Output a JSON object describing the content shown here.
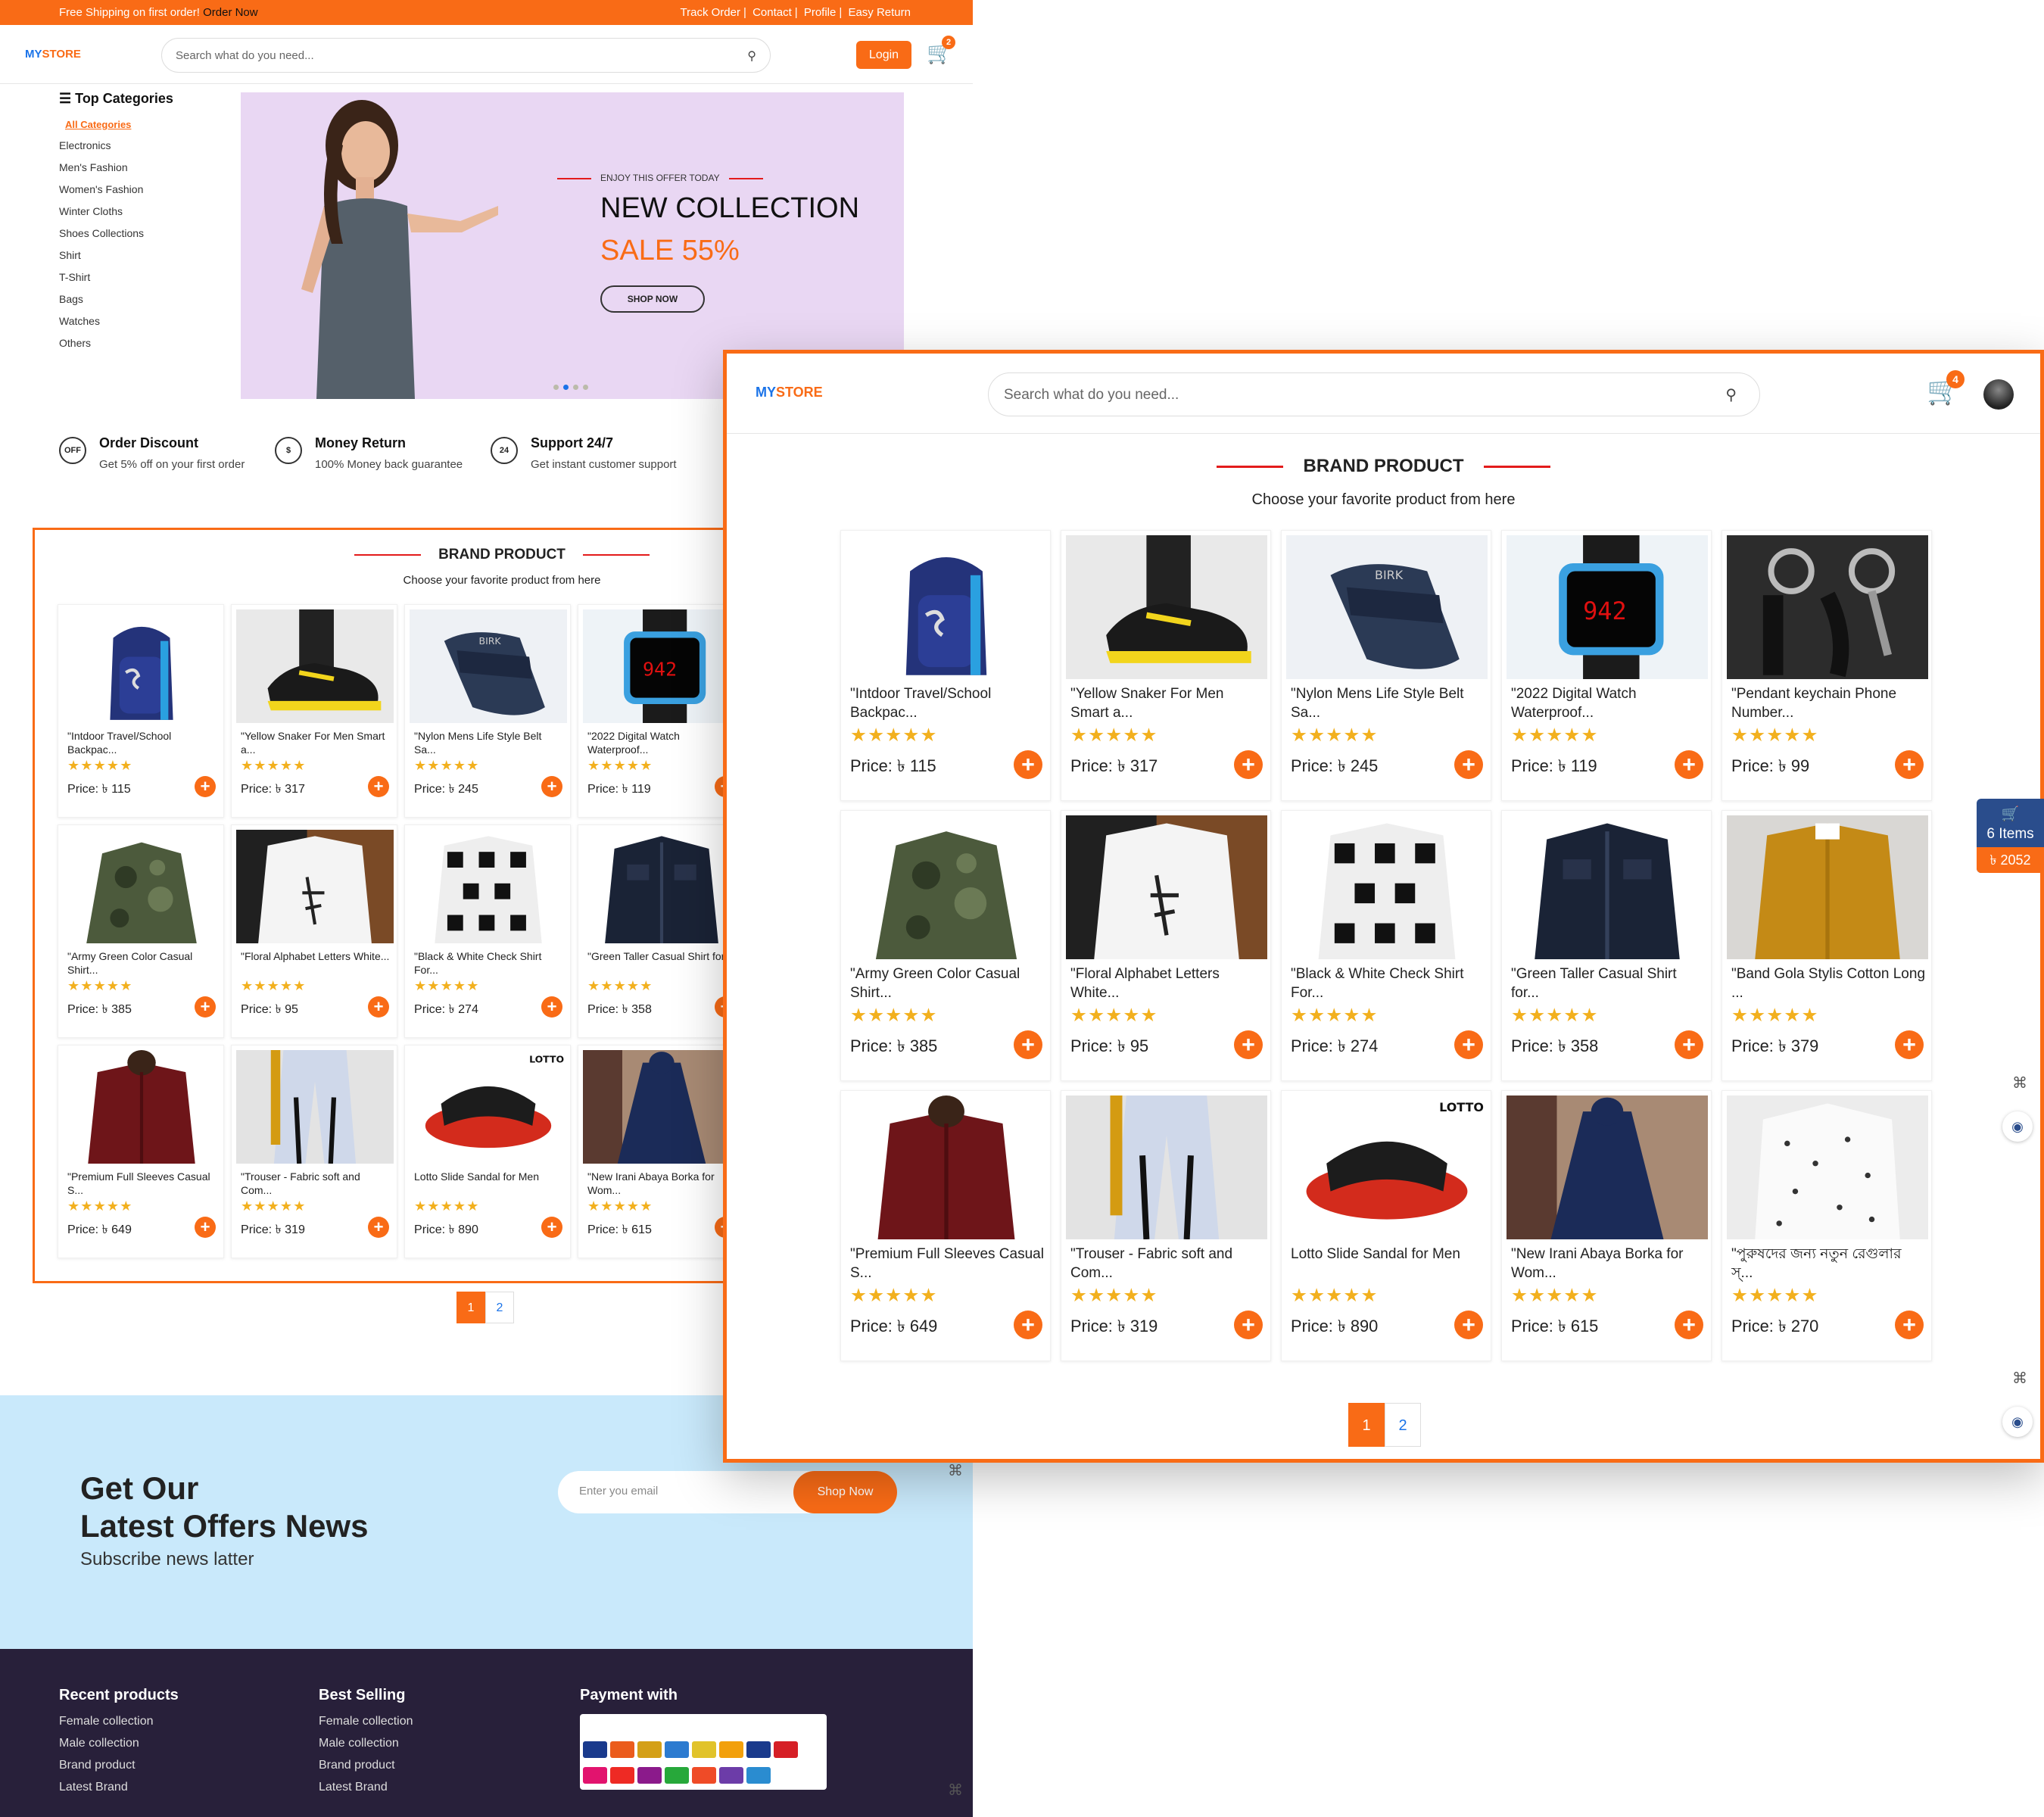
{
  "topbar": {
    "promo": "Free Shipping on first order! ",
    "promo_link": "Order Now",
    "links": [
      "Track Order",
      "Contact",
      "Profile",
      "Easy Return"
    ]
  },
  "brand": {
    "my": "MY",
    "store": "STORE"
  },
  "search": {
    "placeholder": "Search what do you need..."
  },
  "header": {
    "login": "Login",
    "cart_count_small": "2",
    "cart_count_large": "4"
  },
  "categories": {
    "title": "Top Categories",
    "all": "All Categories",
    "items": [
      "Electronics",
      "Men's Fashion",
      "Women's Fashion",
      "Winter Cloths",
      "Shoes Collections",
      "Shirt",
      "T-Shirt",
      "Bags",
      "Watches",
      "Others"
    ]
  },
  "banner": {
    "kicker": "ENJOY THIS OFFER TODAY",
    "title": "NEW COLLECTION",
    "sale": "SALE 55%",
    "button": "SHOP NOW",
    "slide_count": 4,
    "active_slide": 2
  },
  "features": [
    {
      "icon": "OFF",
      "title": "Order Discount",
      "text": "Get 5% off on your first order"
    },
    {
      "icon": "$",
      "title": "Money Return",
      "text": "100% Money back guarantee"
    },
    {
      "icon": "24",
      "title": "Support 24/7",
      "text": "Get instant customer support"
    }
  ],
  "brand_product": {
    "title": "BRAND PRODUCT",
    "subtitle": "Choose your favorite product from here"
  },
  "products": [
    {
      "name": "\"Intdoor Travel/School Backpac...",
      "price": "Price: ৳ 115",
      "rating": 5,
      "image": "backpack"
    },
    {
      "name": "\"Yellow Snaker For Men Smart a...",
      "price": "Price: ৳ 317",
      "rating": 5,
      "image": "sneaker"
    },
    {
      "name": "\"Nylon Mens Life Style Belt Sa...",
      "price": "Price: ৳ 245",
      "rating": 5,
      "image": "sandal"
    },
    {
      "name": "\"2022 Digital Watch Waterproof...",
      "price": "Price: ৳ 119",
      "rating": 5,
      "image": "watch"
    },
    {
      "name": "\"Pendant keychain Phone Number...",
      "price": "Price: ৳ 99",
      "rating": 5,
      "image": "keychain"
    },
    {
      "name": "\"Army Green Color Casual Shirt...",
      "price": "Price: ৳ 385",
      "rating": 5,
      "image": "camo-shirt"
    },
    {
      "name": "\"Floral Alphabet Letters White...",
      "price": "Price: ৳ 95",
      "rating": 5,
      "image": "white-tee"
    },
    {
      "name": "\"Black & White Check Shirt For...",
      "price": "Price: ৳ 274",
      "rating": 5,
      "image": "check-shirt"
    },
    {
      "name": "\"Green Taller Casual Shirt for...",
      "price": "Price: ৳ 358",
      "rating": 5,
      "image": "denim-shirt"
    },
    {
      "name": "\"Band Gola Stylis Cotton Long ...",
      "price": "Price: ৳ 379",
      "rating": 5,
      "image": "mustard-shirt"
    },
    {
      "name": "\"Premium Full Sleeves Casual S...",
      "price": "Price: ৳ 649",
      "rating": 5,
      "image": "maroon-shirt"
    },
    {
      "name": "\"Trouser - Fabric soft and Com...",
      "price": "Price: ৳ 319",
      "rating": 5,
      "image": "trouser"
    },
    {
      "name": "Lotto Slide Sandal for Men",
      "price": "Price: ৳ 890",
      "rating": 5,
      "image": "slide"
    },
    {
      "name": "\"New Irani Abaya Borka for Wom...",
      "price": "Price: ৳ 615",
      "rating": 5,
      "image": "abaya"
    },
    {
      "name": "\"পুরুষদের জন্য নতুন রেগুলার স্...",
      "price": "Price: ৳ 270",
      "rating": 5,
      "image": "dotted-shirt"
    }
  ],
  "pagination": {
    "pages": [
      "1",
      "2"
    ],
    "active": "1"
  },
  "newsletter": {
    "title_line1": "Get Our",
    "title_line2": "Latest Offers News",
    "subtitle": "Subscribe news latter",
    "placeholder": "Enter you email",
    "button": "Shop Now"
  },
  "footer": {
    "recent": {
      "title": "Recent products",
      "items": [
        "Female collection",
        "Male collection",
        "Brand product",
        "Latest Brand"
      ]
    },
    "best": {
      "title": "Best Selling",
      "items": [
        "Female collection",
        "Male collection",
        "Brand product",
        "Latest Brand"
      ]
    },
    "payment_title": "Payment with"
  },
  "side_cart": {
    "items": "6 Items",
    "amount": "৳ 2052"
  },
  "colors": {
    "accent": "#f96b16",
    "blue": "#1a73e8",
    "footer": "#28203a",
    "newsletter": "#c9e9fb",
    "star": "#f2b01e"
  }
}
